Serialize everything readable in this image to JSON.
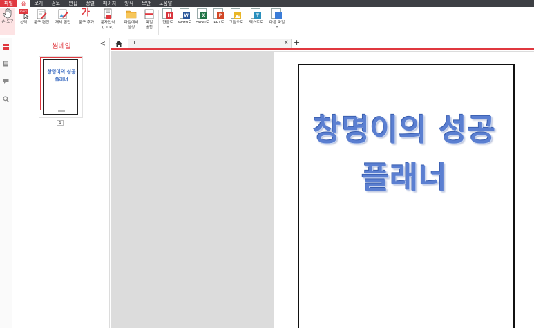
{
  "menu": {
    "items": [
      "파일",
      "홈",
      "보기",
      "검토",
      "편집",
      "정렬",
      "페이지",
      "양식",
      "보안",
      "도움말"
    ],
    "active_index": 1
  },
  "ribbon": {
    "hand_tool": "손 도구",
    "select": "선택",
    "edit_text": "문구 편집",
    "edit_object": "개체 편집",
    "add_text": "문구 추가",
    "ocr_line1": "문자인식",
    "ocr_line2": "(OCR)",
    "create_from_file_line1": "파일에서",
    "create_from_file_line2": "생성",
    "merge_line1": "파일",
    "merge_line2": "병합",
    "to_hwp": "한글로",
    "to_word": "Word로",
    "to_excel": "Excel로",
    "to_ppt": "PPT로",
    "to_image": "그림으로",
    "to_text": "텍스트로",
    "other_file": "다른 파일",
    "add_text_glyph": "가",
    "select_badge": "mark"
  },
  "format_badges": {
    "hwp": "H",
    "word": "W",
    "excel": "X",
    "ppt": "P",
    "text": "T"
  },
  "colors": {
    "accent": "#e0383f",
    "title_blue": "#5b7fd1",
    "hwp": "#d9363e",
    "word": "#2b579a",
    "excel": "#217346",
    "ppt": "#d24726",
    "text": "#2a8fbd",
    "image": "#e9b628"
  },
  "thumbnail_panel": {
    "title": "썸네일",
    "collapse_glyph": "<",
    "page_line1": "창명이의 성공",
    "page_line2": "플래너",
    "page_number": "1"
  },
  "tabs": {
    "doc_tab_label": "1",
    "close_glyph": "×",
    "new_tab_glyph": "+"
  },
  "document": {
    "title_line1": "창명이의 성공",
    "title_line2": "플래너"
  }
}
